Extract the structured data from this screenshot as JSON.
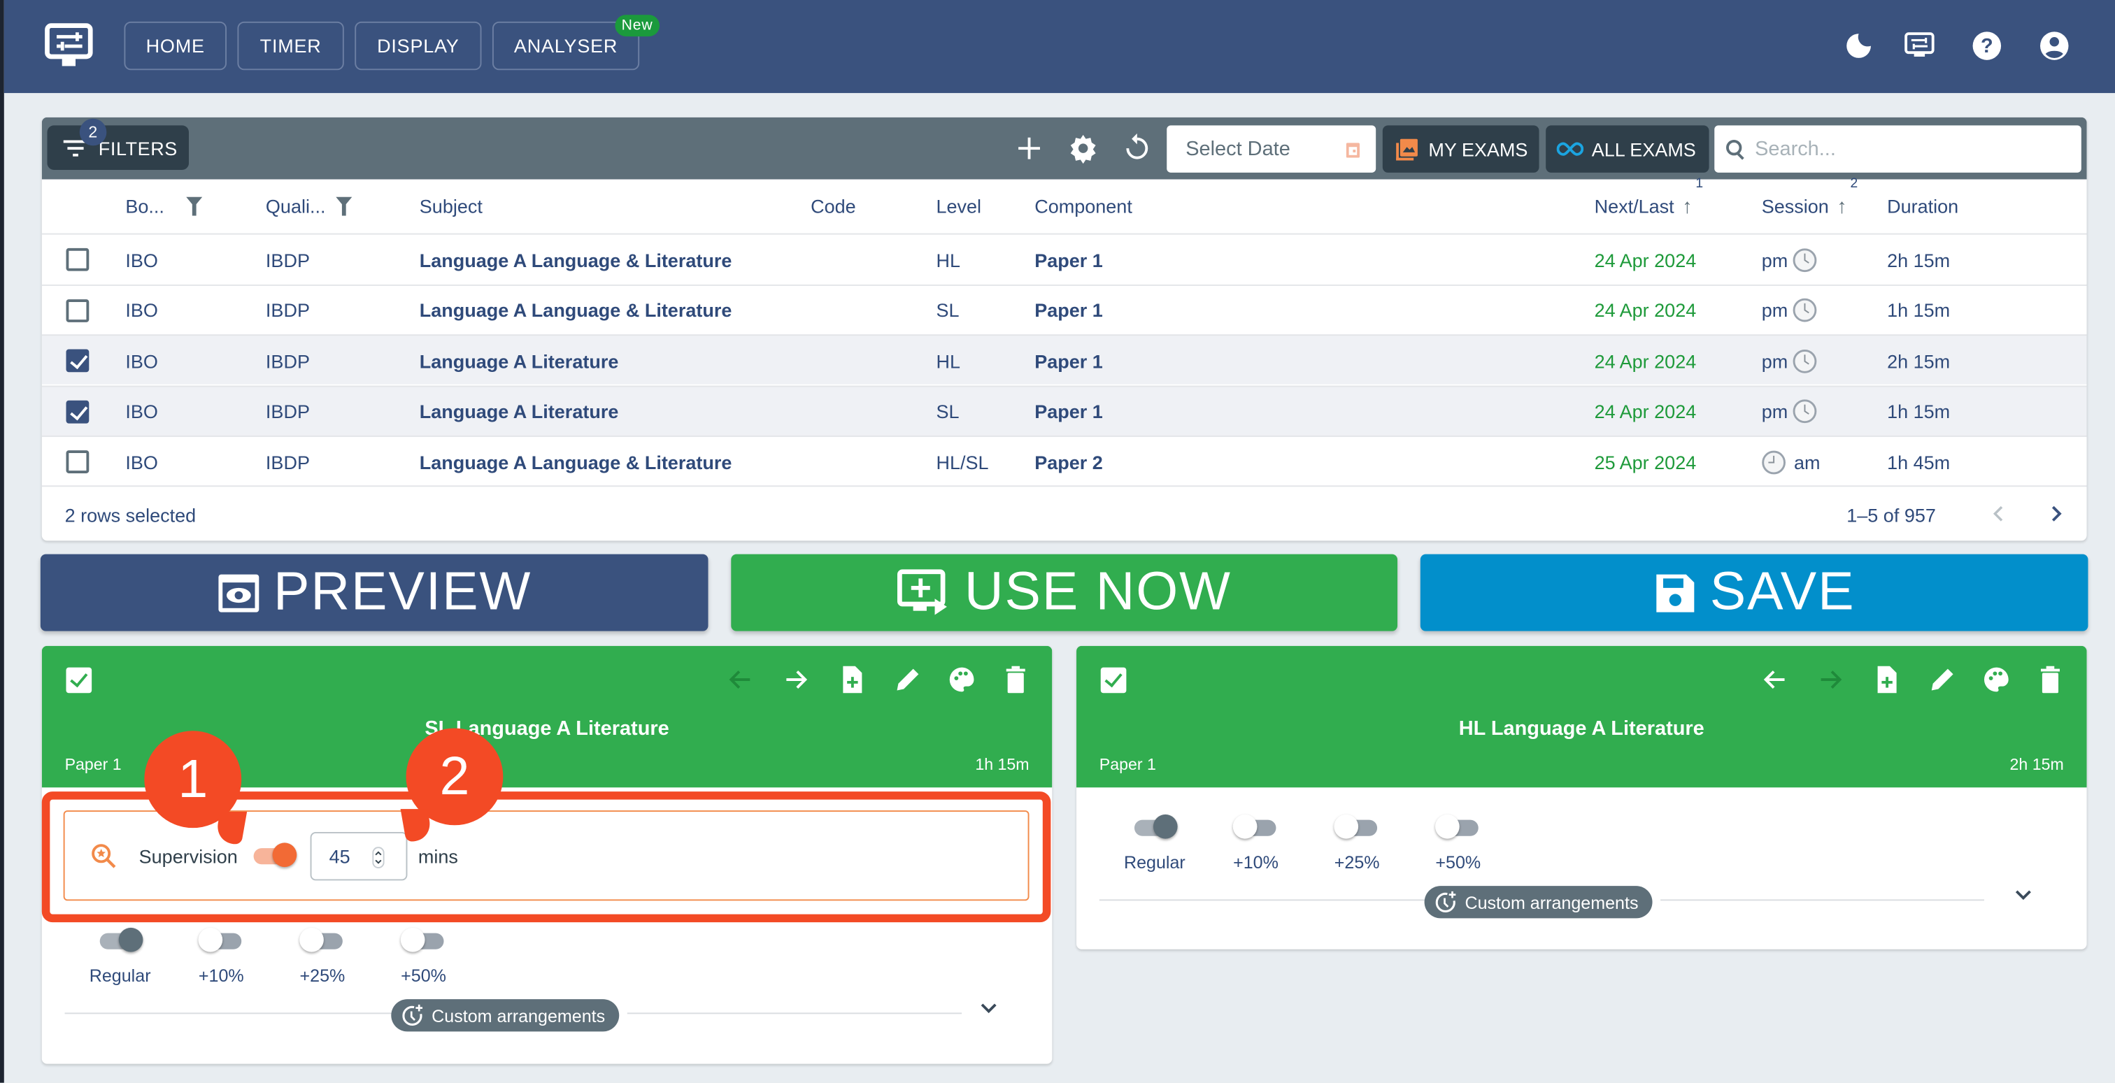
{
  "header": {
    "nav": [
      {
        "label": "HOME"
      },
      {
        "label": "TIMER"
      },
      {
        "label": "DISPLAY"
      },
      {
        "label": "ANALYSER",
        "badge": "New"
      }
    ],
    "icons": [
      "moon-icon",
      "display-settings-icon",
      "help-icon",
      "account-icon"
    ]
  },
  "toolbar": {
    "filters_label": "FILTERS",
    "filters_count": "2",
    "date_placeholder": "Select Date",
    "my_exams_label": "MY EXAMS",
    "all_exams_label": "ALL EXAMS",
    "search_placeholder": "Search..."
  },
  "table": {
    "columns": [
      {
        "label": "Bo..."
      },
      {
        "label": "Quali..."
      },
      {
        "label": "Subject"
      },
      {
        "label": "Code"
      },
      {
        "label": "Level"
      },
      {
        "label": "Component"
      },
      {
        "label": "Next/Last",
        "sort_rank": "1"
      },
      {
        "label": "Session",
        "sort_rank": "2"
      },
      {
        "label": "Duration"
      }
    ],
    "rows": [
      {
        "checked": false,
        "board": "IBO",
        "qual": "IBDP",
        "subject": "Language A Language & Literature",
        "code": "",
        "level": "HL",
        "component": "Paper 1",
        "date": "24 Apr 2024",
        "session": "pm",
        "duration": "2h 15m"
      },
      {
        "checked": false,
        "board": "IBO",
        "qual": "IBDP",
        "subject": "Language A Language & Literature",
        "code": "",
        "level": "SL",
        "component": "Paper 1",
        "date": "24 Apr 2024",
        "session": "pm",
        "duration": "1h 15m"
      },
      {
        "checked": true,
        "board": "IBO",
        "qual": "IBDP",
        "subject": "Language A Literature",
        "code": "",
        "level": "HL",
        "component": "Paper 1",
        "date": "24 Apr 2024",
        "session": "pm",
        "duration": "2h 15m"
      },
      {
        "checked": true,
        "board": "IBO",
        "qual": "IBDP",
        "subject": "Language A Literature",
        "code": "",
        "level": "SL",
        "component": "Paper 1",
        "date": "24 Apr 2024",
        "session": "pm",
        "duration": "1h 15m"
      },
      {
        "checked": false,
        "board": "IBO",
        "qual": "IBDP",
        "subject": "Language A Language & Literature",
        "code": "",
        "level": "HL/SL",
        "component": "Paper 2",
        "date": "25 Apr 2024",
        "session": "am",
        "duration": "1h 45m"
      }
    ],
    "selected_text": "2 rows selected",
    "pagination": "1–5 of 957"
  },
  "actions": {
    "preview_label": "PREVIEW",
    "use_now_label": "USE NOW",
    "save_label": "SAVE"
  },
  "cards": [
    {
      "title": "SL Language A Literature",
      "component": "Paper 1",
      "duration": "1h 15m",
      "supervision": {
        "label": "Supervision",
        "enabled": true,
        "value": "45",
        "unit": "mins"
      },
      "arrangements": [
        {
          "label": "Regular",
          "on": true
        },
        {
          "label": "+10%",
          "on": false
        },
        {
          "label": "+25%",
          "on": false
        },
        {
          "label": "+50%",
          "on": false
        }
      ],
      "custom_label": "Custom arrangements"
    },
    {
      "title": "HL Language A Literature",
      "component": "Paper 1",
      "duration": "2h 15m",
      "arrangements": [
        {
          "label": "Regular",
          "on": true
        },
        {
          "label": "+10%",
          "on": false
        },
        {
          "label": "+25%",
          "on": false
        },
        {
          "label": "+50%",
          "on": false
        }
      ],
      "custom_label": "Custom arrangements"
    }
  ],
  "annotations": [
    {
      "number": "1"
    },
    {
      "number": "2"
    }
  ],
  "colors": {
    "appbar": "#3a527e",
    "toolbar": "#5e6f79",
    "preview": "#3a527e",
    "use_now": "#31ad4f",
    "save": "#028fcb",
    "card_header": "#31ad4f",
    "date_green": "#1e9a3a",
    "annotation": "#f34a25",
    "supervision_accent": "#f28a4a"
  }
}
